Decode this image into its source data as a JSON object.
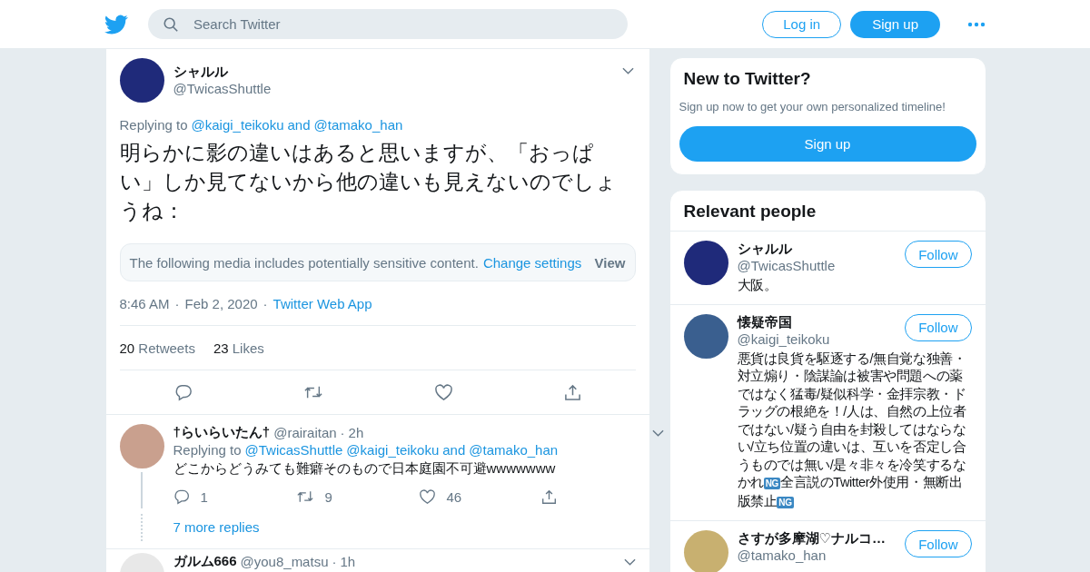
{
  "header": {
    "search": {
      "placeholder": "Search Twitter"
    },
    "login": "Log in",
    "signup": "Sign up"
  },
  "tweet": {
    "name": "シャルル",
    "handle": "@TwicasShuttle",
    "replying_label": "Replying to",
    "replying_to": [
      "@kaigi_teikoku",
      "@tamako_han"
    ],
    "replying_join": "and",
    "text": "明らかに影の違いはあると思いますが、「おっぱい」しか見てないから他の違いも見えないのでしょうね：",
    "sensitive": {
      "notice": "The following media includes potentially sensitive content.",
      "link": "Change settings",
      "view": "View"
    },
    "time": "8:46 AM",
    "separator": "·",
    "date": "Feb 2, 2020",
    "source": "Twitter Web App",
    "retweets": {
      "count": "20",
      "label": "Retweets"
    },
    "likes": {
      "count": "23",
      "label": "Likes"
    }
  },
  "replies": [
    {
      "name": "†らいらいたん†",
      "handle": "@rairaitan",
      "separator": "·",
      "age": "2h",
      "replying_label": "Replying to",
      "replying_to": [
        "@TwicasShuttle",
        "@kaigi_teikoku"
      ],
      "replying_join": "and",
      "replying_last": "@tamako_han",
      "text": "どこからどうみても難癖そのもので日本庭園不可避wwwwwww",
      "reply_count": "1",
      "retweet_count": "9",
      "like_count": "46",
      "more": "7 more replies"
    },
    {
      "name": "ガルム666",
      "handle": "@you8_matsu",
      "separator": "·",
      "age": "1h"
    }
  ],
  "sidebar": {
    "new": {
      "title": "New to Twitter?",
      "subtitle": "Sign up now to get your own personalized timeline!",
      "button": "Sign up"
    },
    "relevant": {
      "title": "Relevant people",
      "people": [
        {
          "name": "シャルル",
          "handle": "@TwicasShuttle",
          "follow": "Follow",
          "bio": [
            {
              "kind": "text",
              "text": "大阪。"
            }
          ]
        },
        {
          "name": "懐疑帝国",
          "handle": "@kaigi_teikoku",
          "follow": "Follow",
          "bio": [
            {
              "kind": "text",
              "text": "悪貨は良貨を駆逐する/無自覚な独善・対立煽り・陰謀論は被害や問題への薬ではなく猛毒/疑似科学・金拝宗教・ドラッグの根絶を！/人は、自然の上位者ではない/疑う自由を封殺してはならない/立ち位置の違いは、互いを否定し合うものでは無い/是々非々を冷笑するなかれ"
            },
            {
              "kind": "badge",
              "text": "NG"
            },
            {
              "kind": "text",
              "text": "全言説のTwitter外使用・無断出版禁止"
            },
            {
              "kind": "badge",
              "text": "NG"
            }
          ]
        },
        {
          "name": "さすが多摩湖♡ナルコ…",
          "handle": "@tamako_han",
          "follow": "Follow"
        }
      ]
    }
  }
}
